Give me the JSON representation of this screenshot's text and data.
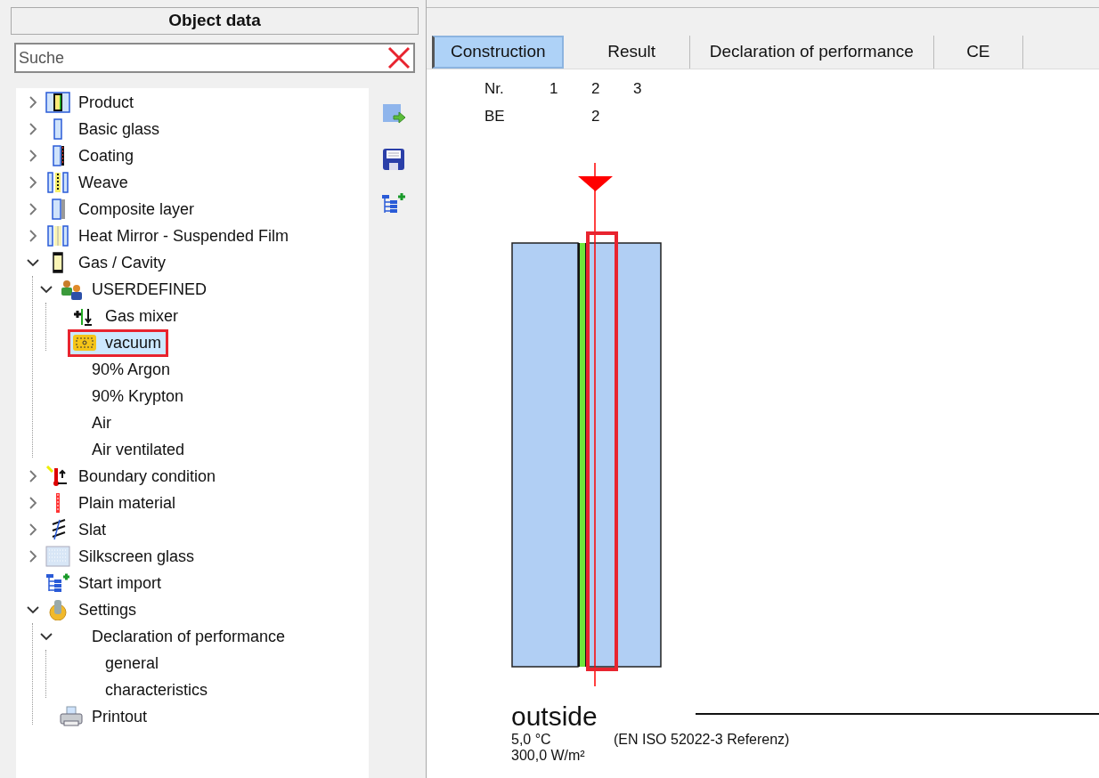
{
  "panel": {
    "title": "Object data"
  },
  "search": {
    "placeholder": "Suche"
  },
  "tree": [
    {
      "label": "Product",
      "kind": "product",
      "expanded": false,
      "selected": false
    },
    {
      "label": "Basic glass",
      "kind": "glass",
      "expanded": false,
      "selected": false
    },
    {
      "label": "Coating",
      "kind": "coating",
      "expanded": false,
      "selected": false
    },
    {
      "label": "Weave",
      "kind": "weave",
      "expanded": false,
      "selected": false
    },
    {
      "label": "Composite layer",
      "kind": "composite",
      "expanded": false,
      "selected": false
    },
    {
      "label": "Heat Mirror - Suspended Film",
      "kind": "film",
      "expanded": false,
      "selected": false
    },
    {
      "label": "Gas / Cavity",
      "kind": "cavity",
      "expanded": true,
      "selected": false,
      "children": [
        {
          "label": "USERDEFINED",
          "kind": "group",
          "expanded": true,
          "selected": false,
          "children": [
            {
              "label": "Gas mixer",
              "kind": "mixer",
              "selected": false
            },
            {
              "label": "vacuum",
              "kind": "vacuum",
              "selected": true
            }
          ]
        },
        {
          "label": "90% Argon",
          "kind": "gas",
          "selected": false
        },
        {
          "label": "90% Krypton",
          "kind": "gas",
          "selected": false
        },
        {
          "label": "Air",
          "kind": "gas",
          "selected": false
        },
        {
          "label": "Air ventilated",
          "kind": "gas",
          "selected": false
        }
      ]
    },
    {
      "label": "Boundary condition",
      "kind": "boundary",
      "expanded": false,
      "selected": false
    },
    {
      "label": "Plain material",
      "kind": "material",
      "expanded": false,
      "selected": false
    },
    {
      "label": "Slat",
      "kind": "slat",
      "expanded": false,
      "selected": false
    },
    {
      "label": "Silkscreen glass",
      "kind": "silkscreen",
      "expanded": false,
      "selected": false
    },
    {
      "label": "Start import",
      "kind": "import",
      "selected": false
    },
    {
      "label": "Settings",
      "kind": "settings",
      "expanded": true,
      "selected": false,
      "children": [
        {
          "label": "Declaration of performance",
          "kind": "section",
          "expanded": true,
          "selected": false,
          "children": [
            {
              "label": "general",
              "kind": "section",
              "selected": false
            },
            {
              "label": "characteristics",
              "kind": "section",
              "selected": false
            }
          ]
        },
        {
          "label": "Printout",
          "kind": "printout",
          "selected": false
        }
      ]
    }
  ],
  "tabs": [
    {
      "label": "Construction",
      "selected": true
    },
    {
      "label": "Result",
      "selected": false
    },
    {
      "label": "Declaration of performance",
      "selected": false
    },
    {
      "label": "CE",
      "selected": false
    }
  ],
  "layer_table": {
    "row_labels": [
      "Nr.",
      "BE"
    ],
    "columns": [
      {
        "nr": "1"
      },
      {
        "nr": "2",
        "be": "2"
      },
      {
        "nr": "3"
      }
    ]
  },
  "boundary": {
    "side": "outside",
    "temperature": "5,0 °C",
    "irradiance": "300,0 W/m²",
    "standard": "(EN ISO 52022-3 Referenz)"
  }
}
